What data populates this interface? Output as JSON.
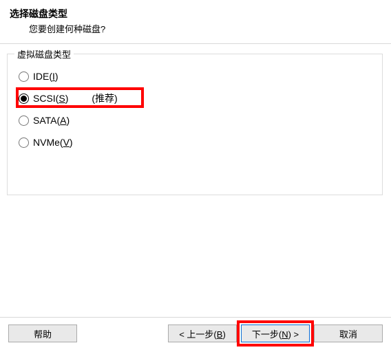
{
  "header": {
    "title": "选择磁盘类型",
    "subtitle": "您要创建何种磁盘?"
  },
  "group": {
    "label": "虚拟磁盘类型",
    "options": [
      {
        "prefix": "IDE(",
        "hotkey": "I",
        "postfix": ")",
        "suffix": "",
        "selected": false
      },
      {
        "prefix": "SCSI(",
        "hotkey": "S",
        "postfix": ")",
        "suffix": "(推荐)",
        "selected": true
      },
      {
        "prefix": "SATA(",
        "hotkey": "A",
        "postfix": ")",
        "suffix": "",
        "selected": false
      },
      {
        "prefix": "NVMe(",
        "hotkey": "V",
        "postfix": ")",
        "suffix": "",
        "selected": false
      }
    ]
  },
  "footer": {
    "help": "帮助",
    "back": {
      "prefix": "< 上一步(",
      "hotkey": "B",
      "postfix": ")"
    },
    "next": {
      "prefix": "下一步(",
      "hotkey": "N",
      "postfix": ") >"
    },
    "cancel": "取消"
  }
}
